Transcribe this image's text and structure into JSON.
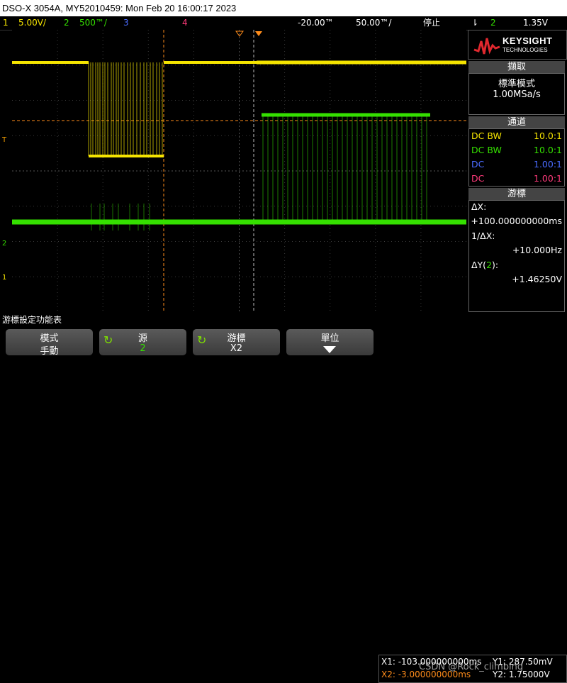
{
  "window_title": "DSO-X 3054A, MY52010459: Mon Feb 20 16:00:17 2023",
  "status": {
    "ch1_num": "1",
    "ch1_scale": "5.00V/",
    "ch2_num": "2",
    "ch2_scale": "500™/",
    "ch3_num": "3",
    "ch4_num": "4",
    "time_offset": "-20.00™",
    "time_scale": "50.00™/",
    "run_state": "停止",
    "trig_channel": "2",
    "trig_level": "1.35V"
  },
  "markers": {
    "trigger": "T",
    "ch2": "2",
    "ch1": "1"
  },
  "panel": {
    "brand": "KEYSIGHT",
    "brand_sub": "TECHNOLOGIES",
    "acq_header": "擷取",
    "acq_mode": "標準模式",
    "sample_rate": "1.00MSa/s",
    "channels_header": "通道",
    "channels": [
      {
        "label": "DC BW",
        "value": "10.0:1",
        "color": "#f5e400"
      },
      {
        "label": "DC BW",
        "value": "10.0:1",
        "color": "#35e000"
      },
      {
        "label": "DC",
        "value": "1.00:1",
        "color": "#4a6bff"
      },
      {
        "label": "DC",
        "value": "1.00:1",
        "color": "#ff3a7a"
      }
    ],
    "cursor_header": "游標",
    "dx_label": "ΔX:",
    "dx_value": "+100.000000000ms",
    "inv_dx_label": "1/ΔX:",
    "inv_dx_value": "+10.000Hz",
    "dy_label": "ΔY(",
    "dy_ch": "2",
    "dy_label_end": "):",
    "dy_value": "+1.46250V"
  },
  "softkey_title": "游標設定功能表",
  "softkeys": [
    {
      "top": "模式",
      "bottom": "手動"
    },
    {
      "top": "源",
      "bottom": "2"
    },
    {
      "top": "游標",
      "bottom": "X2"
    },
    {
      "top": "單位",
      "bottom": ""
    }
  ],
  "cursor_readout": {
    "x1": "X1: -103.000000000ms",
    "y1": "Y1: 287.50mV",
    "x2": "X2: -3.000000000ms",
    "y2": "Y2: 1.75000V",
    "watermark": "CSDN @Rock_climbing"
  },
  "colors": {
    "ch1": "#f5e400",
    "ch2": "#35e000",
    "cursor_x1": "#ff8c1a",
    "ch3": "#4a6bff",
    "ch4": "#ff3a7a"
  }
}
